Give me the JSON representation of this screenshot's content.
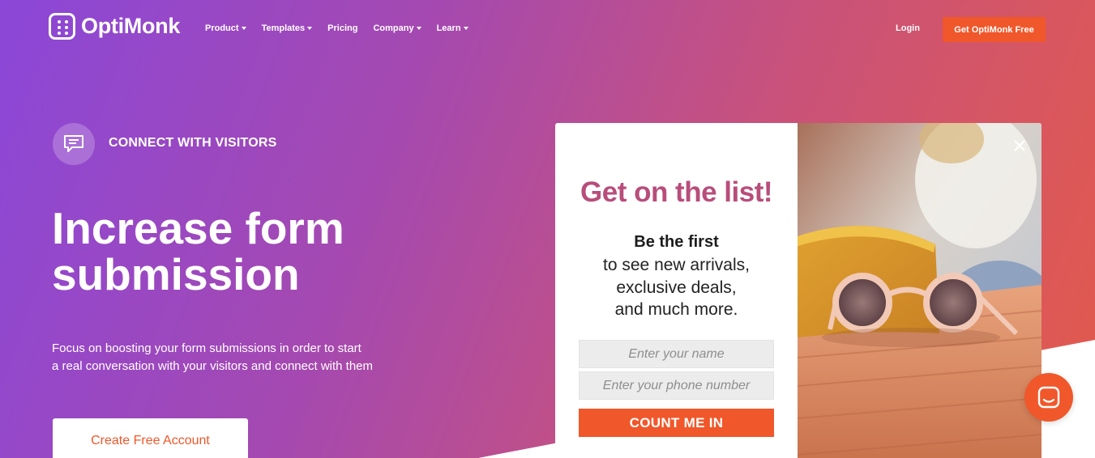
{
  "nav": {
    "logo_text": "OptiMonk",
    "menu": [
      {
        "label": "Product",
        "dropdown": true
      },
      {
        "label": "Templates",
        "dropdown": true
      },
      {
        "label": "Pricing",
        "dropdown": false
      },
      {
        "label": "Company",
        "dropdown": true
      },
      {
        "label": "Learn",
        "dropdown": true
      }
    ],
    "login_label": "Login",
    "cta_label": "Get OptiMonk Free"
  },
  "hero": {
    "badge_icon": "chat-bubble-icon",
    "badge_text": "CONNECT WITH VISITORS",
    "title_line1": "Increase form",
    "title_line2": "submission",
    "desc_line1": "Focus on boosting your form submissions in order to start",
    "desc_line2": "a real conversation with your visitors and connect with them",
    "create_label": "Create Free Account"
  },
  "popup": {
    "heading": "Get on the list!",
    "sub_bold": "Be the first",
    "sub_lines": [
      "to see new arrivals,",
      "exclusive deals,",
      "and much more."
    ],
    "name_placeholder": "Enter your name",
    "phone_placeholder": "Enter your phone number",
    "button_label": "COUNT ME IN",
    "image_description": "sunglasses-on-case-photo"
  },
  "colors": {
    "accent": "#f0572a",
    "heading_pink": "#b84d7b",
    "gradient_start": "#8b47d8",
    "gradient_end": "#e35a4b"
  }
}
